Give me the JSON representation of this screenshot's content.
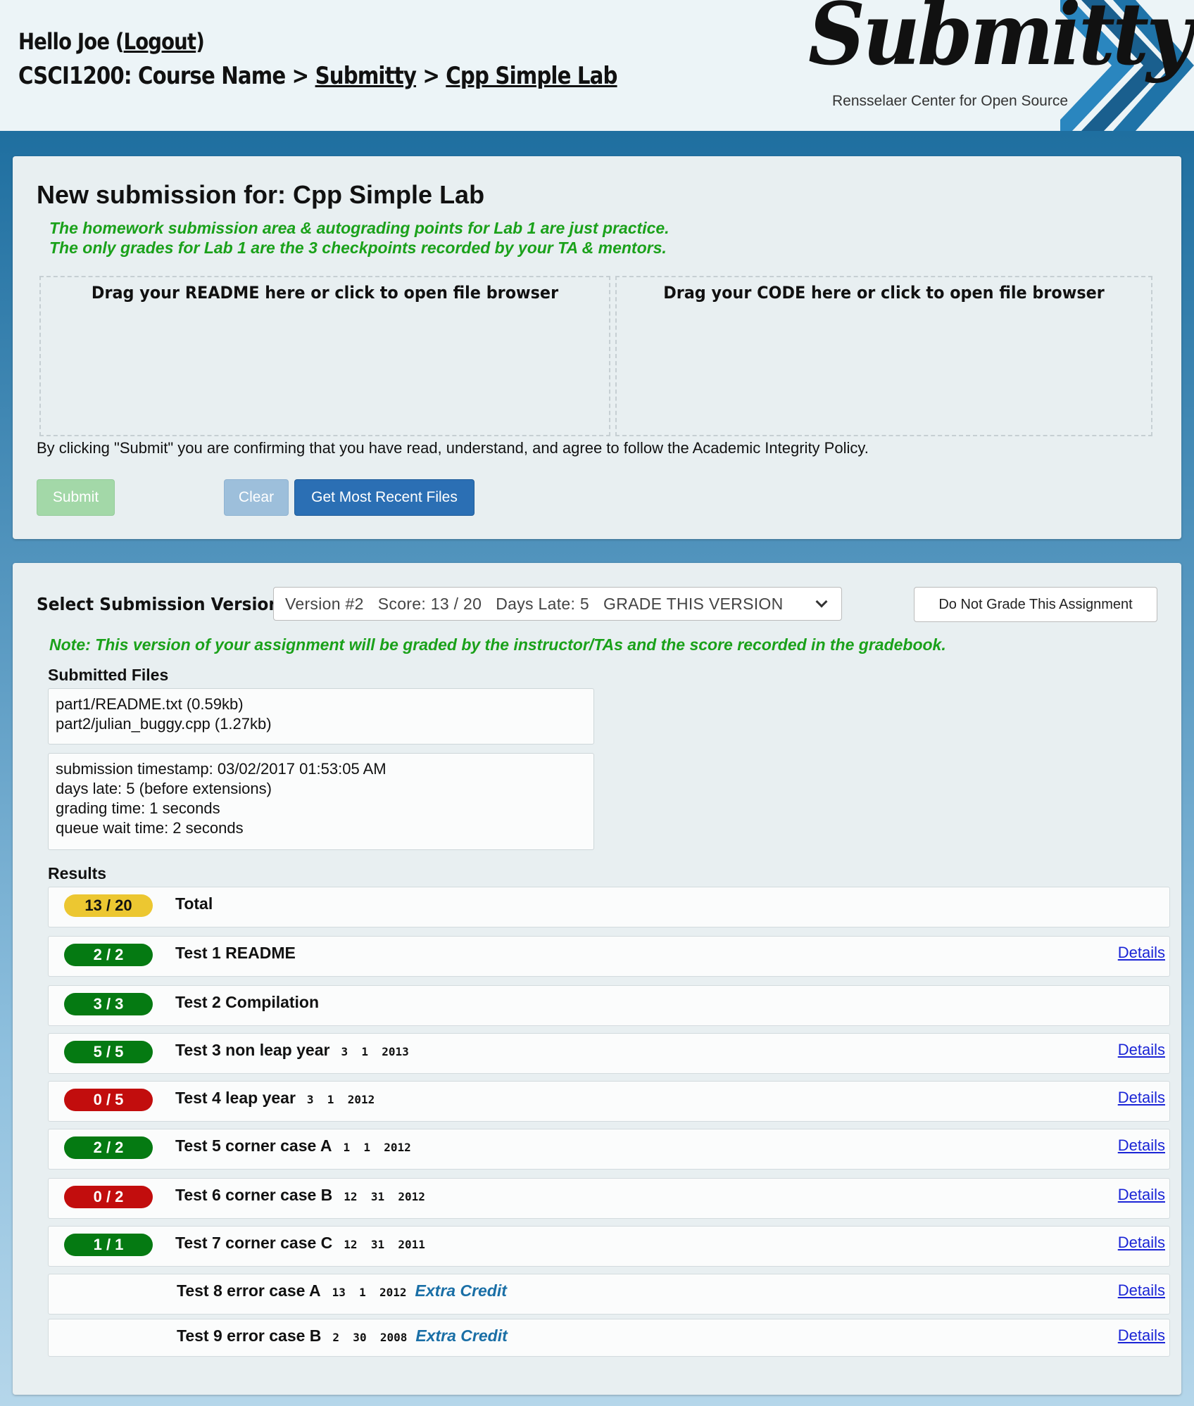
{
  "header": {
    "greeting_prefix": "Hello Joe (",
    "logout_label": "Logout",
    "greeting_suffix": ")",
    "course": "CSCI1200: Course Name",
    "separator": " > ",
    "crumb_submitty": "Submitty",
    "crumb_gradeable": "Cpp Simple Lab",
    "logo_word": "Submitty",
    "logo_sub": "Rensselaer Center for Open Source",
    "logo_colors": [
      "#1a5f8e",
      "#1f73a8"
    ]
  },
  "upload": {
    "title": "New submission for: Cpp Simple Lab",
    "notice_line1": "The homework submission area & autograding points for Lab 1 are just practice.",
    "notice_line2": "The only grades for Lab 1 are the 3 checkpoints recorded by your TA & mentors.",
    "drop_readme": "Drag your README here or click to open file browser",
    "drop_code": "Drag your CODE here or click to open file browser",
    "integrity": "By clicking \"Submit\" you are confirming that you have read, understand, and agree to follow the Academic Integrity Policy.",
    "submit_label": "Submit",
    "clear_label": "Clear",
    "recent_label": "Get Most Recent Files"
  },
  "version": {
    "select_label": "Select Submission Version:",
    "selected_option": "Version #2   Score: 13 / 20   Days Late: 5   GRADE THIS VERSION",
    "do_not_grade_label": "Do Not Grade This Assignment",
    "note": "Note: This version of your assignment will be graded by the instructor/TAs and the score recorded in the gradebook.",
    "files_label": "Submitted Files",
    "files": [
      "part1/README.txt (0.59kb)",
      "part2/julian_buggy.cpp (1.27kb)"
    ],
    "meta": [
      "submission timestamp: 03/02/2017 01:53:05 AM",
      "days late: 5 (before extensions)",
      "grading time: 1 seconds",
      "queue wait time: 2 seconds"
    ],
    "results_label": "Results",
    "details_label": "Details",
    "extra_credit_label": "Extra Credit"
  },
  "results": [
    {
      "score": "13 / 20",
      "status": "yellow",
      "name": "Total",
      "args": "",
      "extra": false,
      "details": false
    },
    {
      "score": "2 / 2",
      "status": "green",
      "name": "Test 1 README",
      "args": "",
      "extra": false,
      "details": true
    },
    {
      "score": "3 / 3",
      "status": "green",
      "name": "Test 2 Compilation",
      "args": "",
      "extra": false,
      "details": false
    },
    {
      "score": "5 / 5",
      "status": "green",
      "name": "Test 3 non leap year",
      "args": "3  1  2013",
      "extra": false,
      "details": true
    },
    {
      "score": "0 / 5",
      "status": "red",
      "name": "Test 4 leap year",
      "args": "3  1  2012",
      "extra": false,
      "details": true
    },
    {
      "score": "2 / 2",
      "status": "green",
      "name": "Test 5 corner case A",
      "args": "1  1  2012",
      "extra": false,
      "details": true
    },
    {
      "score": "0 / 2",
      "status": "red",
      "name": "Test 6 corner case B",
      "args": "12  31  2012",
      "extra": false,
      "details": true
    },
    {
      "score": "1 / 1",
      "status": "green",
      "name": "Test 7 corner case C",
      "args": "12  31  2011",
      "extra": false,
      "details": true
    },
    {
      "score": "",
      "status": "none",
      "name": "Test 8 error case A",
      "args": "13  1  2012",
      "extra": true,
      "details": true
    },
    {
      "score": "",
      "status": "none",
      "name": "Test 9 error case B",
      "args": "2  30  2008",
      "extra": true,
      "details": true
    }
  ]
}
